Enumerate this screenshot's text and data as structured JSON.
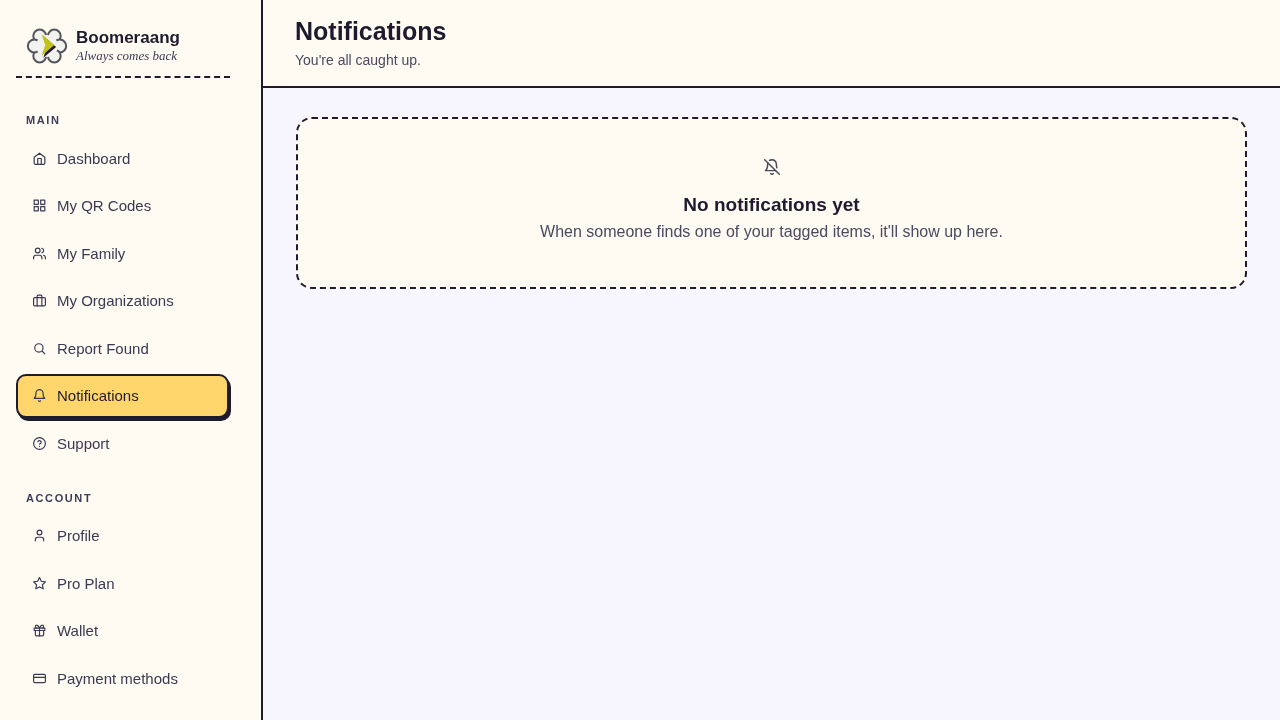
{
  "sidebar": {
    "brand": {
      "name": "Boomeraang",
      "tagline": "Always comes back"
    },
    "sections": [
      {
        "title": "MAIN",
        "items": [
          {
            "label": "Dashboard",
            "selected": false
          },
          {
            "label": "My QR Codes",
            "selected": false
          },
          {
            "label": "My Family",
            "selected": false
          },
          {
            "label": "My Organizations",
            "selected": false
          },
          {
            "label": "Report Found",
            "selected": false
          },
          {
            "label": "Notifications",
            "selected": true
          },
          {
            "label": "Support",
            "selected": false
          }
        ]
      },
      {
        "title": "ACCOUNT",
        "items": [
          {
            "label": "Profile",
            "selected": false
          },
          {
            "label": "Pro Plan",
            "selected": false
          },
          {
            "label": "Wallet",
            "selected": false
          },
          {
            "label": "Payment methods",
            "selected": false
          }
        ]
      }
    ]
  },
  "page_header": {
    "title": "Notifications",
    "subtitle": "You're all caught up."
  },
  "empty_state": {
    "title": "No notifications yet",
    "message": "When someone finds one of your tagged items, it'll show up here."
  }
}
